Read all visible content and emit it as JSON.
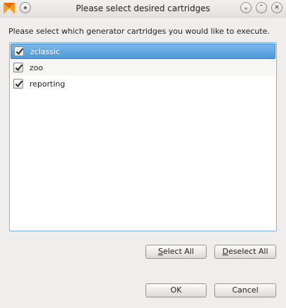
{
  "window": {
    "title": "Please select desired cartridges"
  },
  "prompt": "Please select which generator cartridges you would like to execute.",
  "cartridges": [
    {
      "label": "zclassic",
      "checked": true,
      "selected": true
    },
    {
      "label": "zoo",
      "checked": true,
      "selected": false
    },
    {
      "label": "reporting",
      "checked": true,
      "selected": false
    }
  ],
  "buttons": {
    "select_all": {
      "mnemonic": "S",
      "rest": "elect All"
    },
    "deselect_all": {
      "mnemonic": "D",
      "rest": "eselect All"
    },
    "ok": "OK",
    "cancel": "Cancel"
  },
  "colors": {
    "selection": "#4f98d8",
    "dialog_bg": "#efeeec"
  }
}
